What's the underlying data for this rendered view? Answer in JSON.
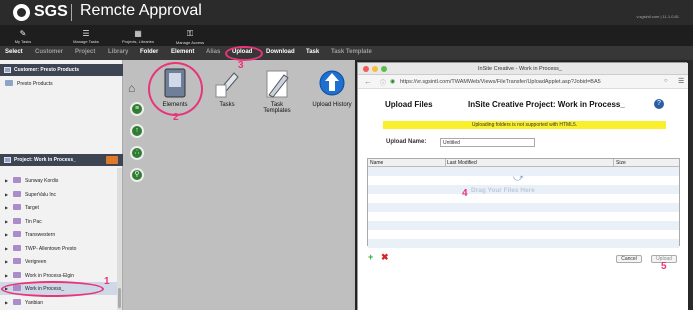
{
  "header": {
    "brand": "SGS",
    "app_title": "Remcte Approval",
    "user_info": "v.sgsintl.com | 11.1.0.81"
  },
  "toolbar": [
    {
      "label": "My Tasks",
      "icon": "tasks-icon"
    },
    {
      "label": "Manage Tasks",
      "icon": "manage-tasks-icon"
    },
    {
      "label": "Projects, Libraries",
      "icon": "projects-icon"
    },
    {
      "label": "Manage Access",
      "icon": "key-icon"
    }
  ],
  "menu": [
    "Select",
    "Customer",
    "Project",
    "Library",
    "Folder",
    "Element",
    "Alias",
    "Upload",
    "Download",
    "Task",
    "Task Template"
  ],
  "menu_active": [
    "Select",
    "Folder",
    "Element",
    "Upload",
    "Download",
    "Task"
  ],
  "left": {
    "customer_header": "Customer: Presto Products",
    "customer_item": "Presto Products",
    "project_header": "Project: Work in Process_",
    "projects": [
      "Sunway Kordis",
      "SuperValu Inc",
      "Target",
      "Tin Pac",
      "Transwestern",
      "TWP- Allentown Presto",
      "Verigreen",
      "Work in Process-Elgin",
      "Work in Process_",
      "Yanbian"
    ],
    "selected_project": "Work in Process_"
  },
  "tools": [
    {
      "label": "Elements",
      "icon": "elements-icon"
    },
    {
      "label": "Tasks",
      "icon": "tasks-icon"
    },
    {
      "label": "Task Templates",
      "icon": "task-templates-icon"
    },
    {
      "label": "Upload History",
      "icon": "upload-history-icon"
    }
  ],
  "popup": {
    "window_title": "InSite Creative - Work in Process_",
    "url": "https://vr.sgsintl.com/TWAMWeb/Views/FileTransfer/UploadApplet.asp?Jobid=BA5",
    "heading": "Upload Files",
    "project_heading": "InSite Creative Project: Work in Process_",
    "help": "?",
    "warning": "Uploading folders is not supported with HTML5.",
    "upload_name_label": "Upload Name:",
    "upload_name_value": "Untitled",
    "columns": [
      "Name",
      "Last Modified",
      "Size"
    ],
    "drop_text": "Drag Your Files Here",
    "cancel": "Cancel",
    "upload": "Upload"
  },
  "annotations": [
    "1",
    "2",
    "3",
    "4",
    "5"
  ],
  "colors": {
    "annotation": "#e8357a",
    "warning": "#f9ef2b",
    "header": "#2b2b2b",
    "menubar": "#373737"
  }
}
